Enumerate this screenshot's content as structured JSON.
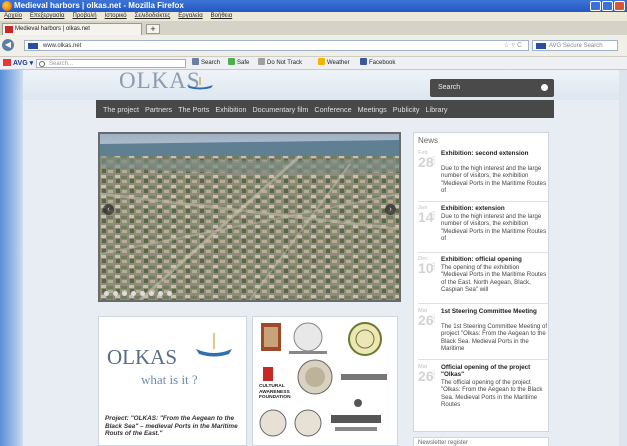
{
  "browser": {
    "window_title": "Medieval harbors | olkas.net - Mozilla Firefox",
    "menu": [
      "Αρχείο",
      "Επεξεργασία",
      "Προβολή",
      "Ιστορικό",
      "Σελιδοδείκτες",
      "Εργαλεία",
      "Βοήθεια"
    ],
    "tab_label": "Medieval harbors | olkas.net",
    "new_tab": "+",
    "url": "www.olkas.net",
    "url_icons": "☆ ▿ C",
    "avg_search_placeholder": "AVG Secure Search",
    "avg_label": "AVG ▾",
    "toolbar_search_placeholder": "Search...",
    "toolbar_items": [
      "Search",
      "Safe",
      "Do Not Track",
      "Weather",
      "Facebook"
    ]
  },
  "site": {
    "logo": "OLKAS",
    "search_placeholder": "Search",
    "nav": [
      "The project",
      "Partners",
      "The Ports",
      "Exhibition",
      "Documentary film",
      "Conference",
      "Meetings",
      "Publicity",
      "Library"
    ],
    "what_logo": "OLKAS",
    "what_text": "what is it ?",
    "what_desc": "Project: \"OLKAS: \"From the Aegean to the Black Sea\" – medieval Ports in the Maritime Routs of the East.\"",
    "partners": [
      "CULTURAL AWARENESS FOUNDATION"
    ]
  },
  "news": {
    "title": "News",
    "items": [
      {
        "month": "Feb",
        "day": "28",
        "year": "2013",
        "title": "Exhibition: second extension",
        "text": "Due to the high interest and the large number of visitors, the exhibition \"Medieval Ports in the Maritime Routes of"
      },
      {
        "month": "Jan",
        "day": "14",
        "year": "2013",
        "title": "Exhibition: extension",
        "text": "Due to the high interest and the large number of visitors, the exhibition \"Medieval Ports in the Maritime Routes of"
      },
      {
        "month": "Dec",
        "day": "10",
        "year": "2012",
        "title": "Exhibition: official opening",
        "text": "The opening of the exhibition \"Medieval Ports in the Maritime Routes of the East. North Aegean, Black, Caspian Sea\" will"
      },
      {
        "month": "Mar",
        "day": "26",
        "year": "2012",
        "title": "1st Steering Committee Meeting",
        "text": "The 1st Steering Committee Meeting of project \"Olkas: From the Aegean to the Black Sea. Medieval Ports in the Maritime"
      },
      {
        "month": "Mar",
        "day": "26",
        "year": "2012",
        "title": "Official opening of the project \"Olkas\"",
        "text": "The official opening of the project \"Olkas: From the Aegean to the Black Sea. Medieval Ports in the Maritime Routes"
      }
    ],
    "newsletter": "Newsletter register"
  },
  "colors": {
    "nav_bg": "#484848",
    "accent": "#2357c2"
  }
}
